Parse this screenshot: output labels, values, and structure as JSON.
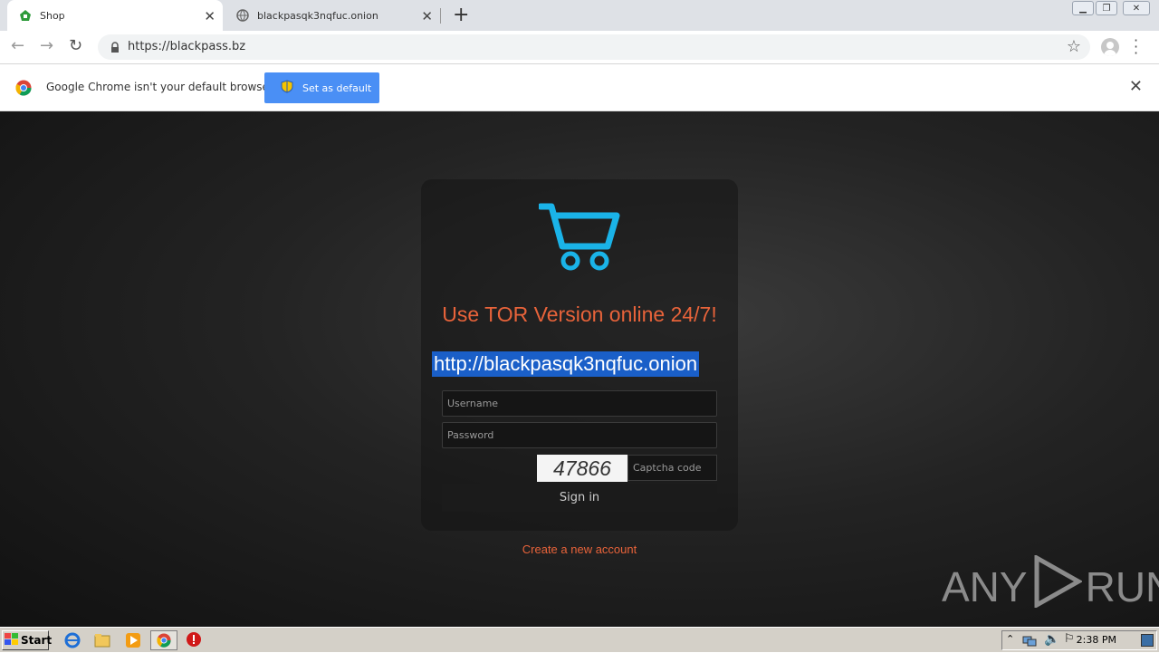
{
  "browser": {
    "tabs": [
      {
        "title": "Shop",
        "active": true
      },
      {
        "title": "blackpasqk3nqfuc.onion",
        "active": false
      }
    ],
    "url": "https://blackpass.bz",
    "infobar": {
      "message": "Google Chrome isn't your default browser",
      "button_label": "Set as default"
    }
  },
  "page": {
    "tor_message": "Use TOR Version online 24/7!",
    "onion_link": "http://blackpasqk3nqfuc.onion",
    "username_placeholder": "Username",
    "password_placeholder": "Password",
    "captcha_code": "47866",
    "captcha_placeholder": "Captcha code",
    "signin_label": "Sign in",
    "create_account_label": "Create a new account",
    "accent_color": "#e8633a",
    "cart_color": "#1ab3e8"
  },
  "watermark": {
    "left": "ANY",
    "right": "RUN"
  },
  "taskbar": {
    "start_label": "Start",
    "clock": "2:38 PM"
  }
}
